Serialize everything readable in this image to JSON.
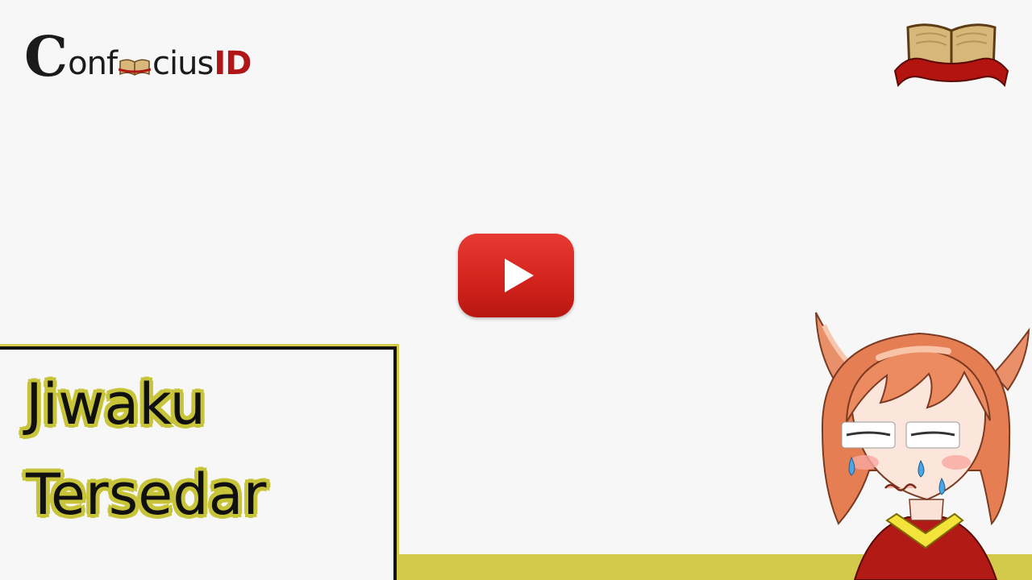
{
  "brand": {
    "logo_initial": "C",
    "logo_text_a": "onf",
    "logo_text_b": "cius",
    "logo_text_id": "ID",
    "logo_icon": "open-book-icon",
    "emblem_icon": "open-book-banner-icon"
  },
  "video": {
    "play_icon": "play-icon"
  },
  "title": {
    "line1": "Jiwaku",
    "line2": "Tersedar"
  },
  "mascot": {
    "icon": "crying-fox-girl-illustration"
  },
  "colors": {
    "background": "#f7f7f7",
    "accent_yellow": "#d3c94a",
    "play_red": "#d4241d",
    "brand_red": "#b01616"
  }
}
